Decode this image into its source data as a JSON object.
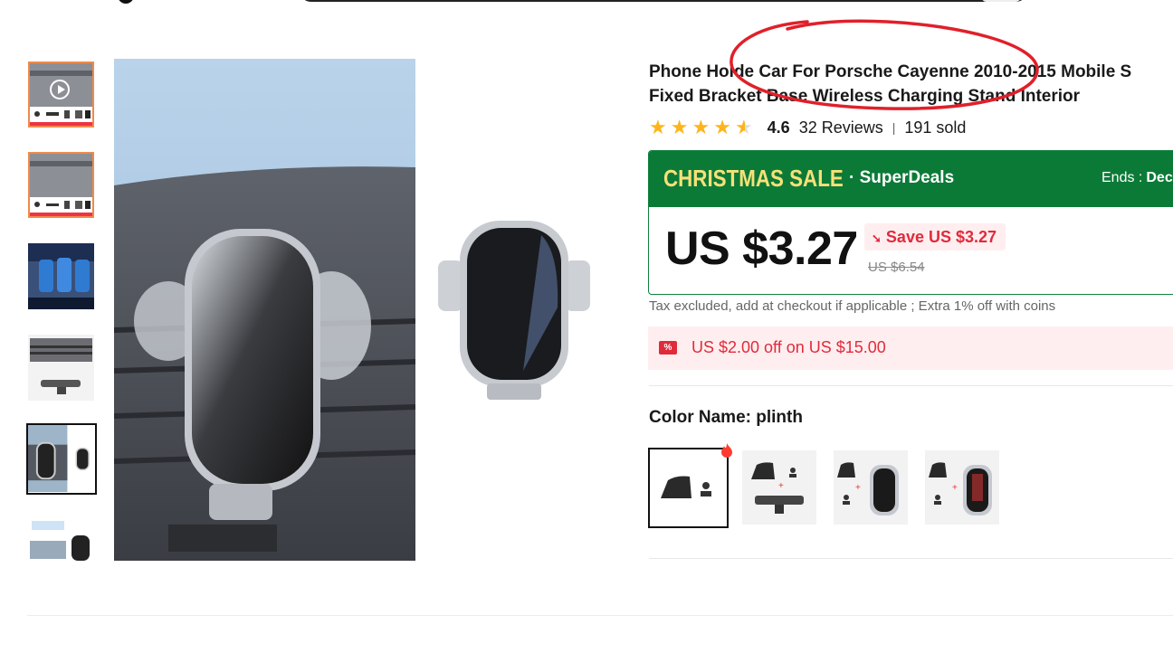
{
  "header": {
    "search_placeholder": ""
  },
  "gallery": {
    "thumbnails": [
      {
        "name": "thumbnail-1-video",
        "has_video": true
      },
      {
        "name": "thumbnail-2"
      },
      {
        "name": "thumbnail-3"
      },
      {
        "name": "thumbnail-4"
      },
      {
        "name": "thumbnail-5",
        "active": true
      },
      {
        "name": "thumbnail-6"
      }
    ]
  },
  "product": {
    "title_line1": "Phone Holde Car For Porsche Cayenne 2010-2015 Mobile S",
    "title_line2": "Fixed Bracket Base Wireless Charging Stand Interior",
    "rating_value": "4.6",
    "stars": 4.5,
    "reviews_text": "32 Reviews",
    "sold_text": "191 sold"
  },
  "sale": {
    "banner": "CHRISTMAS SALE",
    "superdeals": "· SuperDeals",
    "ends_label": "Ends :",
    "ends_value": "Dec",
    "price": "US $3.27",
    "save_text": "Save US $3.27",
    "original_price": "US $6.54",
    "colors": {
      "banner_bg": "#0c7a37",
      "banner_text": "#f6e179",
      "accent_red": "#e02b3a"
    }
  },
  "tax_note": "Tax excluded, add at checkout if applicable ; Extra 1% off with coins",
  "coupon": {
    "icon_text": "%",
    "text": "US $2.00 off on US $15.00"
  },
  "variant": {
    "label": "Color Name: plinth",
    "options": [
      "plinth",
      "option-2",
      "option-3",
      "option-4"
    ],
    "selected": "plinth"
  },
  "icons": {
    "play": "play-icon",
    "star": "star-icon",
    "hot": "fire-icon",
    "coupon": "coupon-icon"
  }
}
